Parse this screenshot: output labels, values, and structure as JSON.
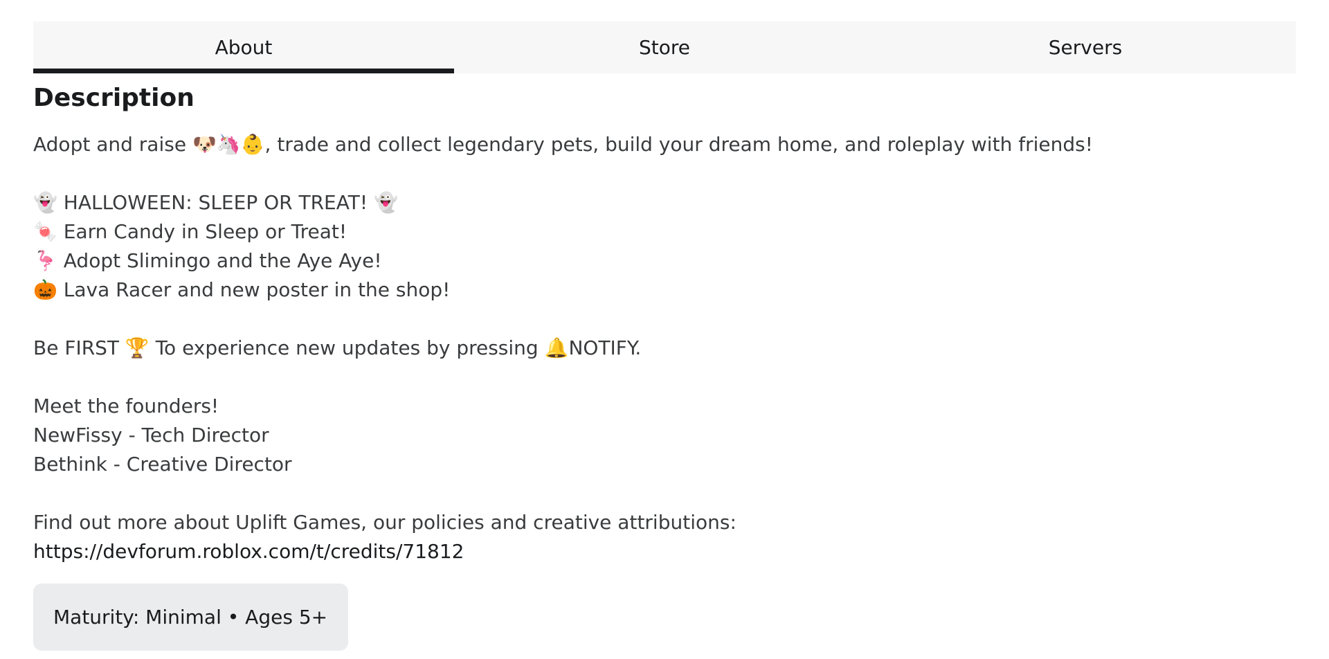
{
  "tabs": [
    {
      "label": "About",
      "active": true
    },
    {
      "label": "Store",
      "active": false
    },
    {
      "label": "Servers",
      "active": false
    }
  ],
  "description": {
    "title": "Description",
    "intro": "Adopt and raise 🐶🦄👶, trade and collect legendary pets, build your dream home, and roleplay with friends!",
    "event_lines": [
      "👻 HALLOWEEN: SLEEP OR TREAT! 👻",
      "🍬 Earn Candy in Sleep or Treat!",
      "🦩 Adopt Slimingo and the Aye Aye!",
      "🎃 Lava Racer and new poster in the shop!"
    ],
    "notify_line": "Be FIRST 🏆 To experience new updates by pressing 🔔NOTIFY.",
    "founders_lines": [
      "Meet the founders!",
      "NewFissy - Tech Director",
      "Bethink - Creative Director"
    ],
    "more_info": "Find out more about Uplift Games, our policies and creative attributions:",
    "link": "https://devforum.roblox.com/t/credits/71812"
  },
  "maturity": {
    "label": "Maturity: Minimal • Ages 5+"
  }
}
